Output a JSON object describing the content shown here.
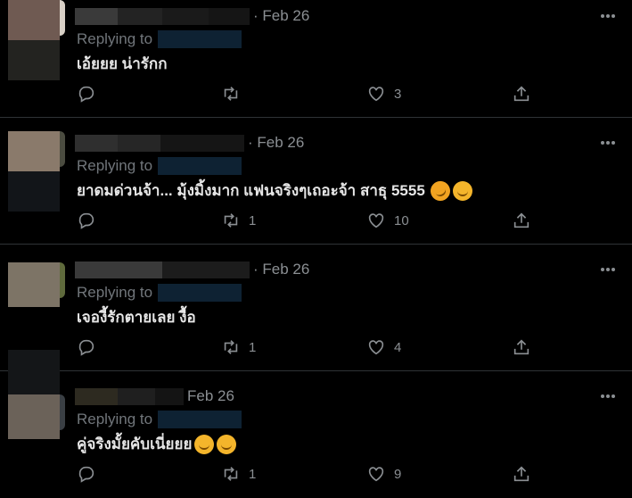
{
  "replying_label": "Replying to",
  "icons": {
    "reply": "reply-icon",
    "retweet": "retweet-icon",
    "like": "heart-icon",
    "share": "share-icon",
    "more": "more-dots-icon"
  },
  "colors": {
    "background": "#000000",
    "separator": "#2f3336",
    "muted": "#8b8f93",
    "handle_redaction": "#0e2233"
  },
  "tweets": [
    {
      "date": "· Feb 26",
      "text": "เอ้ยยย น่ารักก",
      "replies": "",
      "retweets": "",
      "likes": "3"
    },
    {
      "date": "· Feb 26",
      "text": "ยาดมด่วนจ้า... มุ้งมิ้งมาก แฟนจริงๆเถอะจ้า สาธุ 5555",
      "replies": "",
      "retweets": "1",
      "likes": "10"
    },
    {
      "date": "· Feb 26",
      "text": "เจองี้รักตายเลย งื้อ",
      "replies": "",
      "retweets": "1",
      "likes": "4"
    },
    {
      "date": "Feb 26",
      "text": "คู่จริงมั้ยคับเนี่ยยย",
      "replies": "",
      "retweets": "1",
      "likes": "9"
    }
  ]
}
